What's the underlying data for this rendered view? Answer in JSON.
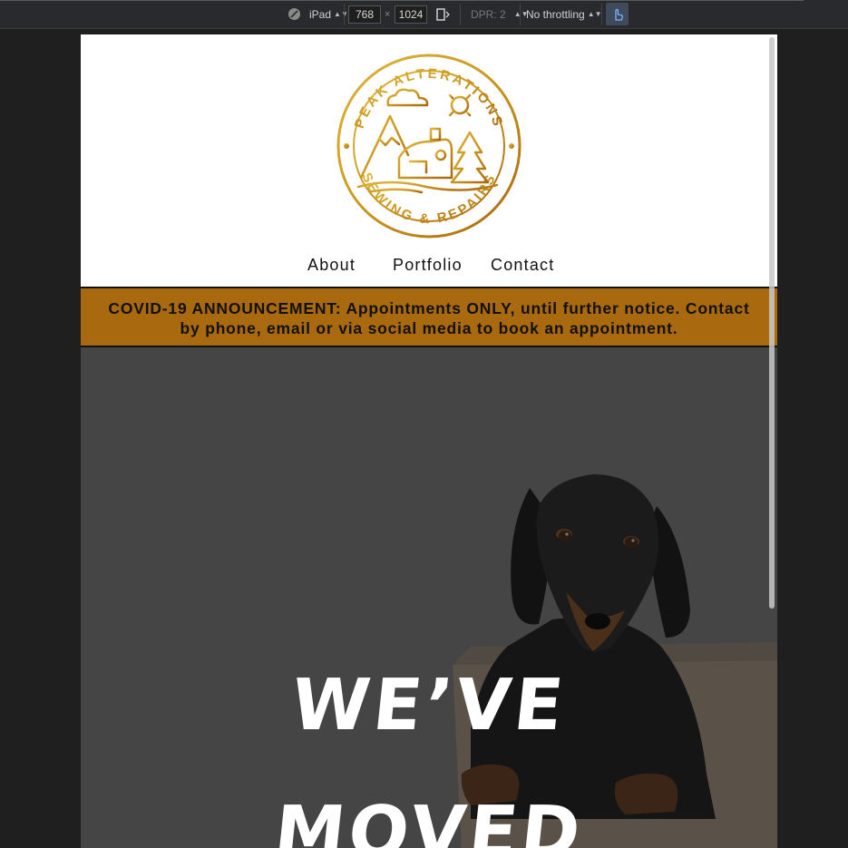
{
  "devtools": {
    "device": "iPad",
    "width_value": "768",
    "times": "×",
    "height_value": "1024",
    "dpr": "DPR: 2",
    "throttling": "No throttling"
  },
  "site": {
    "logo_top_text": "PEAK ALTERATIONS",
    "logo_bottom_text": "SEWING & REPAIRS",
    "nav": [
      "About",
      "Portfolio",
      "Contact"
    ],
    "announcement_line1": "COVID-19 ANNOUNCEMENT: Appointments ONLY, until further notice. Contact",
    "announcement_line2": "by phone, email or via social media to book an appointment.",
    "hero_line1": "WE’VE",
    "hero_line2": "MOVED"
  },
  "colors": {
    "gold": "#c9971f",
    "banner": "#a9690f"
  }
}
